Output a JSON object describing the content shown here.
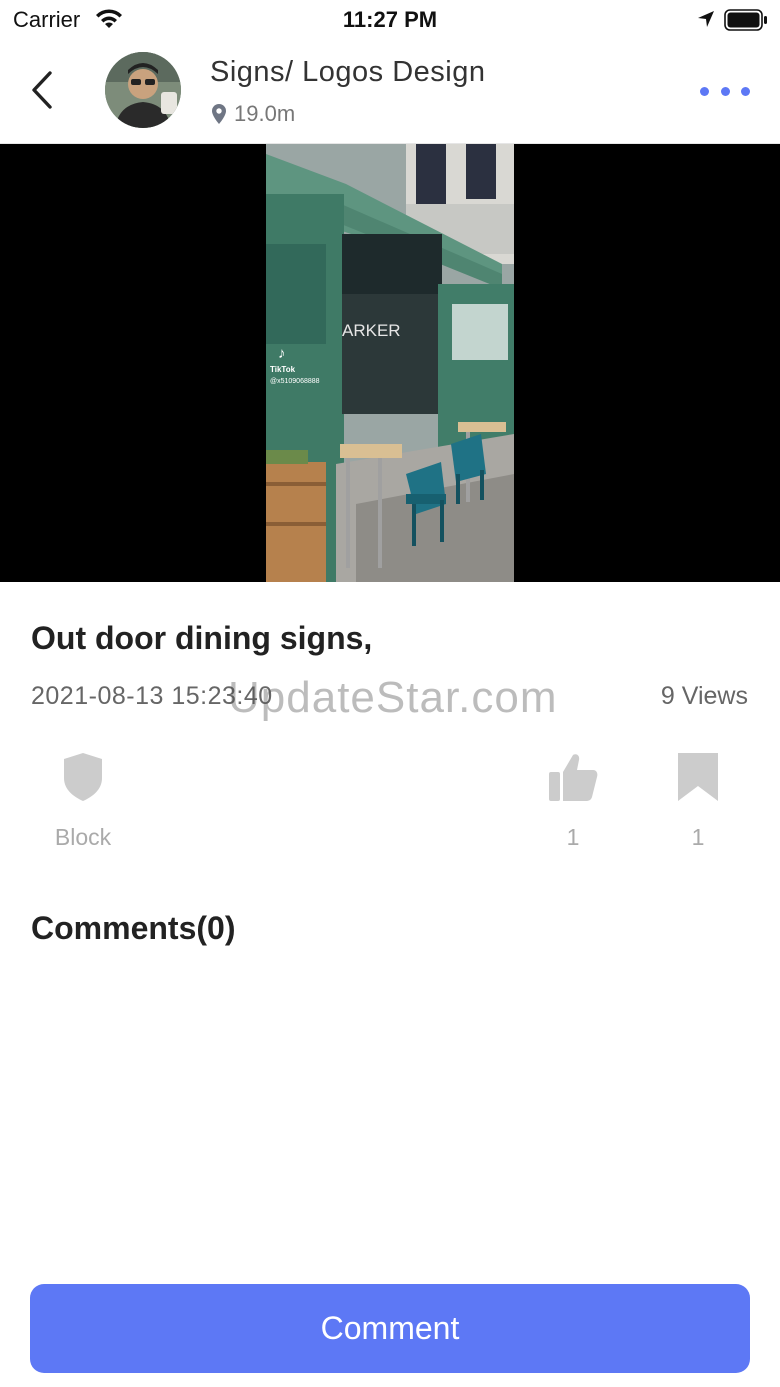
{
  "status_bar": {
    "carrier": "Carrier",
    "time": "11:27 PM"
  },
  "header": {
    "title": "Signs/ Logos Design",
    "distance": "19.0m"
  },
  "media": {
    "overlay_brand": "TikTok",
    "overlay_handle": "@x5109068888",
    "sign_text": "ARKER"
  },
  "post": {
    "title": "Out door dining signs,",
    "date": "2021-08-13 15:23:40",
    "views": "9 Views",
    "watermark": "UpdateStar.com"
  },
  "actions": {
    "block_label": "Block",
    "like_count": "1",
    "bookmark_count": "1"
  },
  "comments": {
    "heading": "Comments(0)"
  },
  "footer": {
    "comment_button_label": "Comment"
  },
  "colors": {
    "accent": "#5d78f5",
    "icon_gray": "#cccccc"
  }
}
